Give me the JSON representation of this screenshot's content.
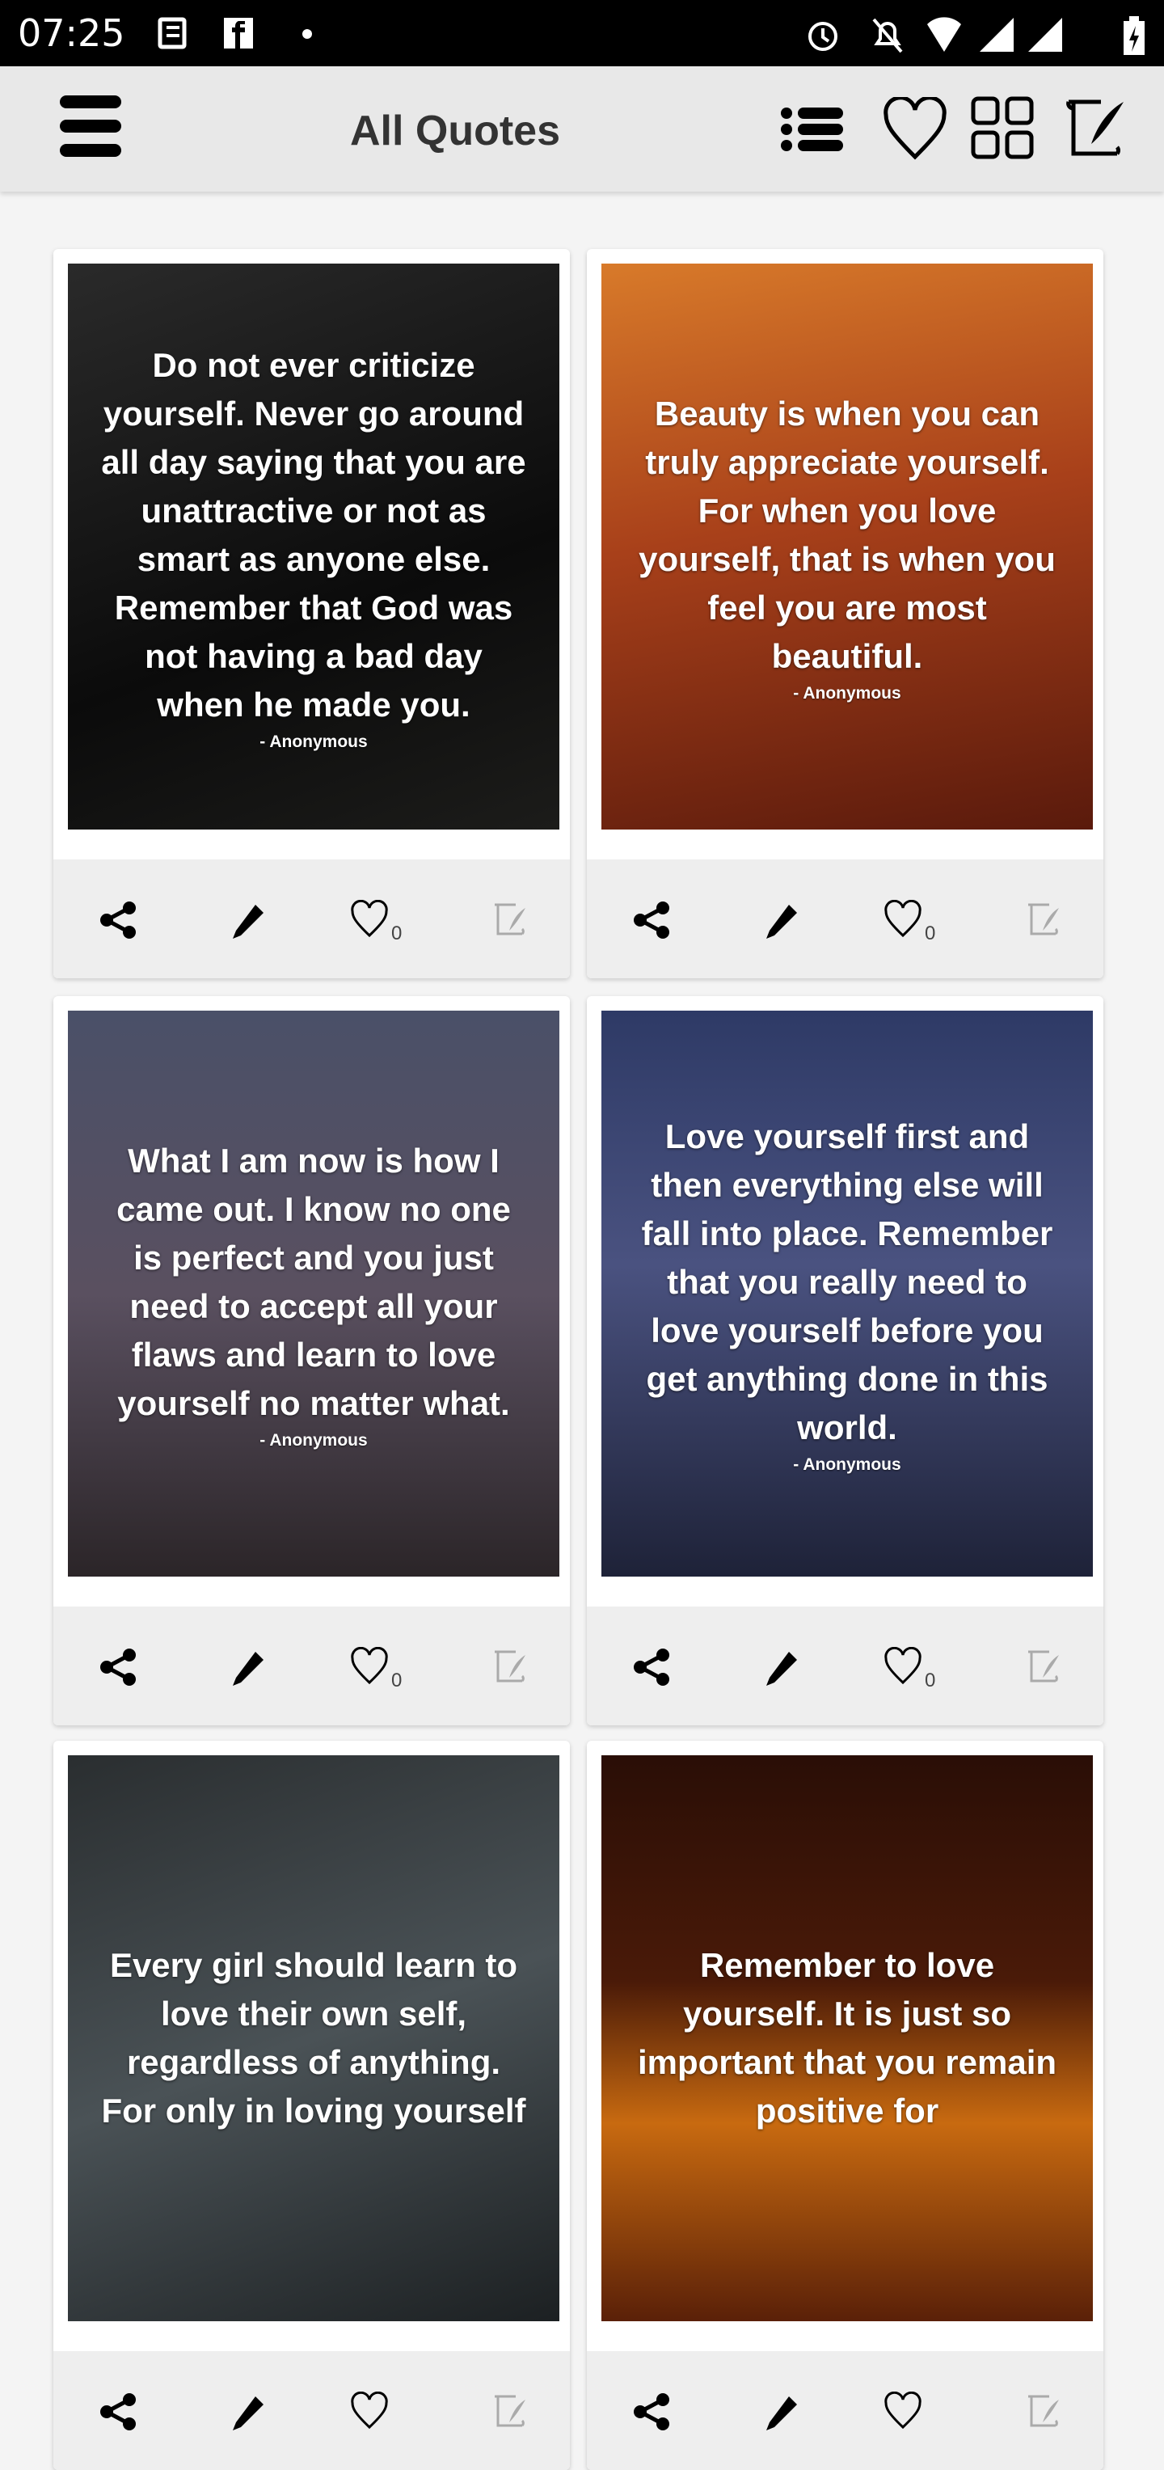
{
  "status_bar": {
    "time": "07:25",
    "icons": [
      "news-icon",
      "facebook-icon",
      "dot-icon",
      "alarm-icon",
      "notifications-off-icon",
      "wifi-icon",
      "signal-icon",
      "signal-icon",
      "battery-charging-icon"
    ]
  },
  "header": {
    "title": "All Quotes",
    "icons": [
      "menu-icon",
      "list-icon",
      "heart-icon",
      "grid-icon",
      "scroll-quill-icon"
    ]
  },
  "quotes": [
    {
      "text": "Do not ever criticize yourself. Never go around all day saying that you are unattractive or not as smart as anyone else. Remember that God was not having a bad day when he made you.",
      "author": "- Anonymous",
      "likes": "0",
      "bg": "linear-gradient(160deg,#2a2a2a,#0b0b0b 60%,#1c1c1a)"
    },
    {
      "text": "Beauty is when you can truly appreciate yourself. For when you love yourself, that is when you feel you are most beautiful.",
      "author": "- Anonymous",
      "likes": "0",
      "bg": "linear-gradient(170deg,#d87a2a,#a8401a 45%,#5a1a0c)"
    },
    {
      "text": "What I am now is how I came out. I know no one is perfect and you just need to accept all your flaws and learn to love yourself no matter what.",
      "author": "- Anonymous",
      "likes": "0",
      "bg": "linear-gradient(180deg,#4a5068,#5a5060 50%,#2b2528)"
    },
    {
      "text": "Love yourself first and then everything else will fall into place. Remember that you really need to love yourself before you get anything done in this world.",
      "author": "- Anonymous",
      "likes": "0",
      "bg": "linear-gradient(180deg,#2e3a66,#4a5280 45%,#1e2238)"
    },
    {
      "text": "Every girl should learn to love their own self, regardless of anything. For only in loving yourself",
      "author": "",
      "likes": "",
      "bg": "linear-gradient(160deg,#2a2e30,#4a5256 50%,#1c2022)"
    },
    {
      "text": "Remember to love yourself. It is just so important that you remain positive for",
      "author": "",
      "likes": "",
      "bg": "linear-gradient(180deg,#2a0e06,#4a1a08 40%,#c86a10 65%,#5a2008)"
    }
  ]
}
